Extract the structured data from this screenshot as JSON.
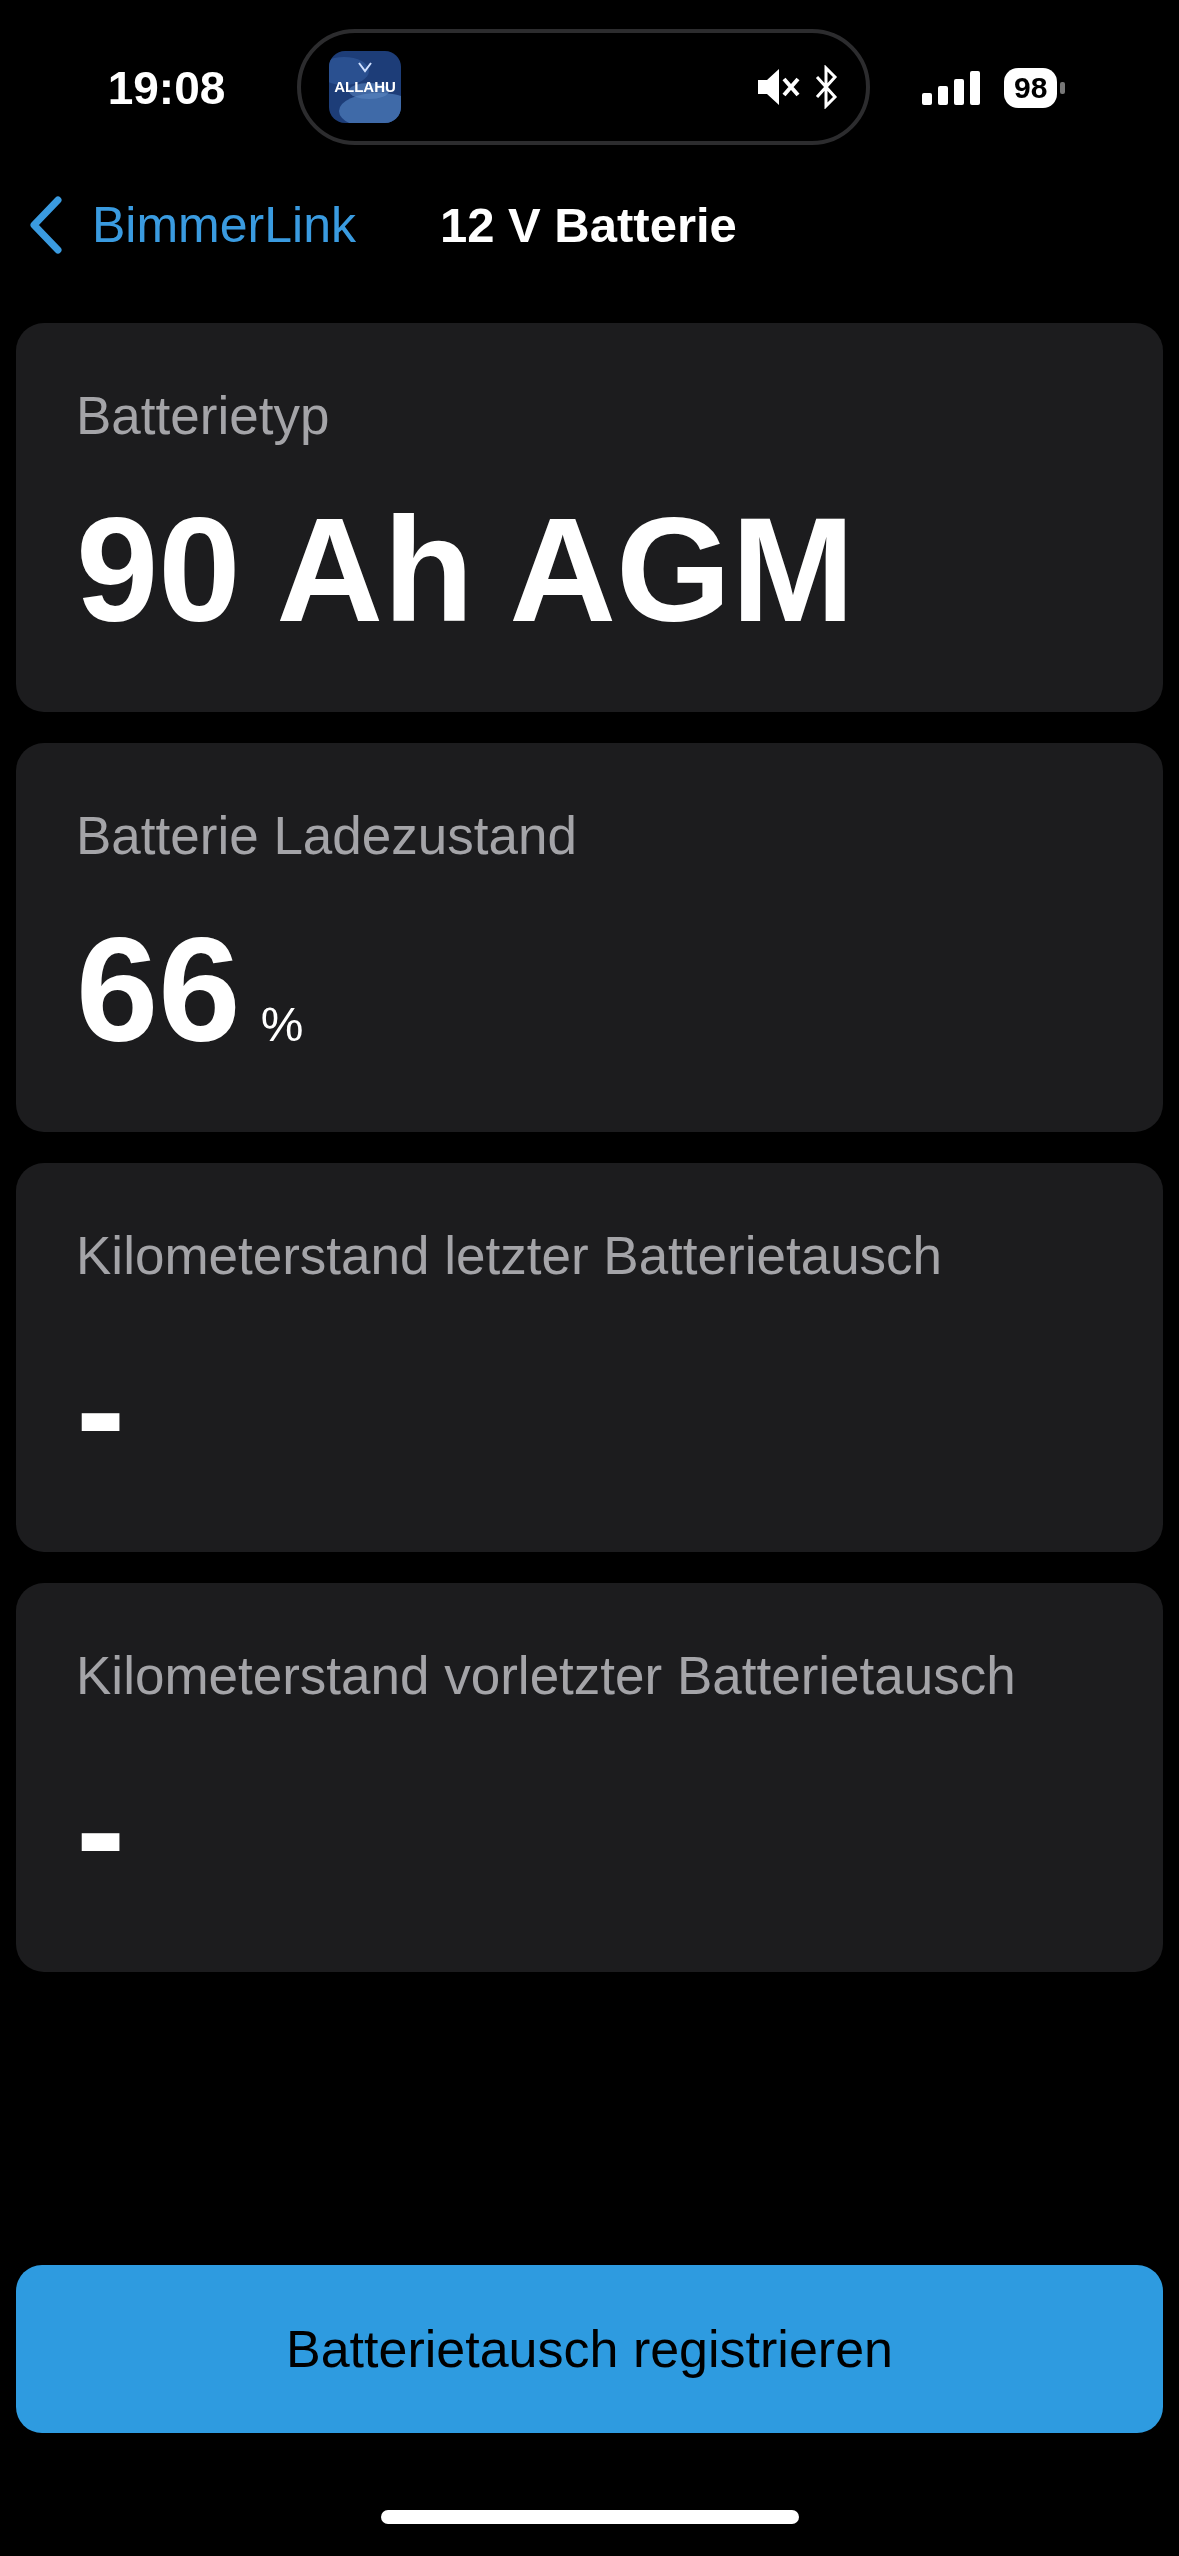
{
  "status_bar": {
    "time": "19:08",
    "island_app_label": "ALLAHU",
    "muted": true,
    "bluetooth": true,
    "battery": "98"
  },
  "nav": {
    "back": "BimmerLink",
    "title": "12 V Batterie"
  },
  "cards": [
    {
      "label": "Batterietyp",
      "value": "90 Ah AGM"
    },
    {
      "label": "Batterie Ladezustand",
      "value": "66",
      "unit": "%"
    },
    {
      "label": "Kilometerstand letzter Batterietausch",
      "value": "-"
    },
    {
      "label": "Kilometerstand vorletzter Batterietausch",
      "value": "-"
    }
  ],
  "button": "Batterietausch registrieren"
}
